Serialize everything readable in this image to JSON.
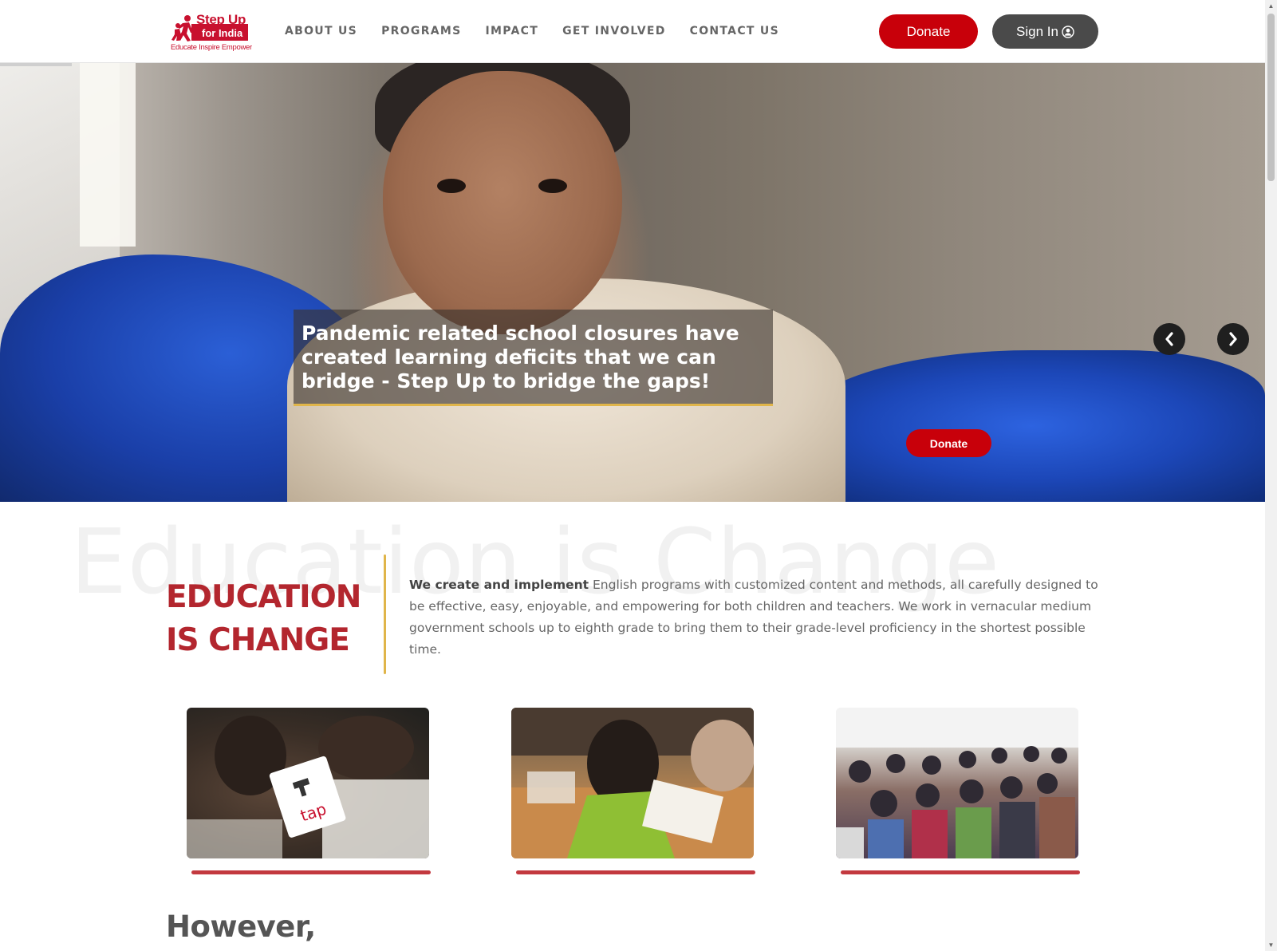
{
  "header": {
    "logo": {
      "title_line1": "Step Up",
      "title_line2": "for India",
      "tagline": "Educate Inspire Empower"
    },
    "nav": [
      {
        "label": "ABOUT US"
      },
      {
        "label": "PROGRAMS"
      },
      {
        "label": "IMPACT"
      },
      {
        "label": "GET INVOLVED"
      },
      {
        "label": "CONTACT US"
      }
    ],
    "donate_label": "Donate",
    "signin_label": "Sign In",
    "signin_icon": "user-circle-icon",
    "colors": {
      "accent_red": "#c8000a",
      "signin_gray": "#4a4a4a"
    }
  },
  "hero": {
    "caption": "Pandemic related school closures have created learning deficits that we can bridge - Step Up to bridge the gaps!",
    "donate_label": "Donate",
    "prev_icon": "chevron-left-icon",
    "next_icon": "chevron-right-icon",
    "caption_accent": "#e0b54a"
  },
  "intro": {
    "watermark": "Education is Change",
    "heading_line1": "EDUCATION",
    "heading_line2": "IS CHANGE",
    "text_bold": "We create and implement",
    "text_rest": " English programs with customized content and methods, all carefully designed to be effective, easy, enjoyable, and empowering for both children and teachers. We work in vernacular medium government schools up to eighth grade to bring them to their grade-level proficiency in the shortest possible time.",
    "heading_color": "#b3262e"
  },
  "cards": [
    {
      "image": "children-reading-flashcard"
    },
    {
      "image": "student-writing-worksheet"
    },
    {
      "image": "teachers-training-classroom"
    }
  ],
  "next_section": {
    "heading": "However,"
  }
}
